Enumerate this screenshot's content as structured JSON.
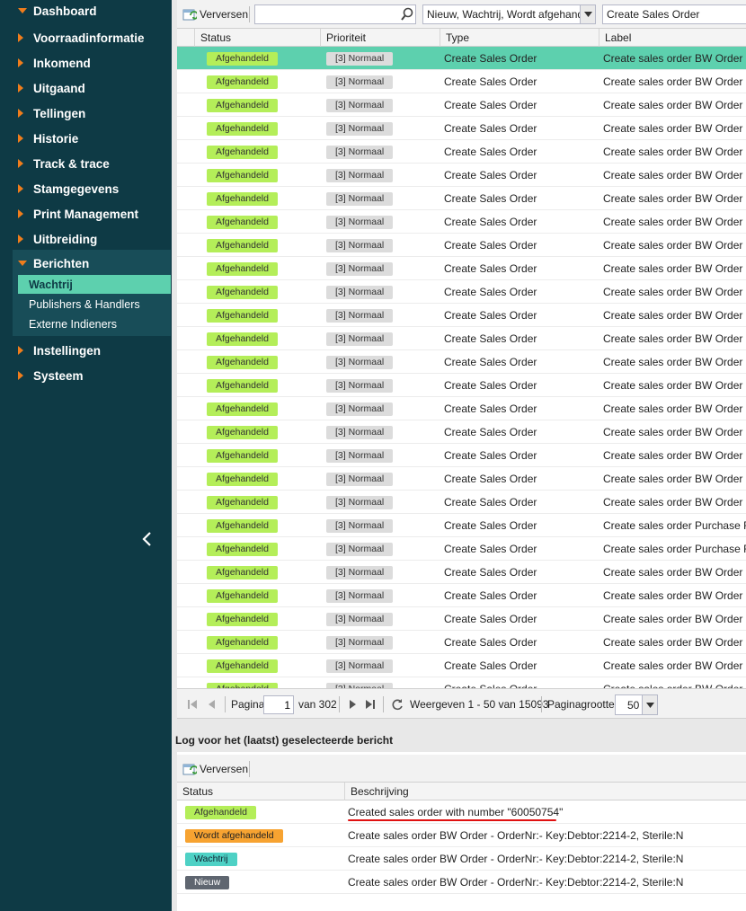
{
  "sidebar": {
    "items": [
      {
        "label": "Dashboard",
        "expanded": true
      },
      {
        "label": "Voorraadinformatie",
        "expanded": false
      },
      {
        "label": "Inkomend",
        "expanded": false
      },
      {
        "label": "Uitgaand",
        "expanded": false
      },
      {
        "label": "Tellingen",
        "expanded": false
      },
      {
        "label": "Historie",
        "expanded": false
      },
      {
        "label": "Track & trace",
        "expanded": false
      },
      {
        "label": "Stamgegevens",
        "expanded": false
      },
      {
        "label": "Print Management",
        "expanded": false
      },
      {
        "label": "Uitbreiding",
        "expanded": false
      },
      {
        "label": "Berichten",
        "expanded": true
      },
      {
        "label": "Instellingen",
        "expanded": false
      },
      {
        "label": "Systeem",
        "expanded": false
      }
    ],
    "sub_items": [
      {
        "label": "Wachtrij",
        "active": true
      },
      {
        "label": "Publishers & Handlers",
        "active": false
      },
      {
        "label": "Externe Indieners",
        "active": false
      }
    ],
    "collapse_icon": "chevron-left-icon"
  },
  "toolbar": {
    "refresh_label": "Verversen",
    "search_value": "",
    "status_filter": "Nieuw, Wachtrij, Wordt afgehandeld",
    "type_filter": "Create Sales Order"
  },
  "grid": {
    "columns": [
      "Status",
      "Prioriteit",
      "Type",
      "Label"
    ],
    "rows": [
      {
        "status": "Afgehandeld",
        "priority": "[3] Normaal",
        "type": "Create Sales Order",
        "label": "Create sales order BW Order - O",
        "selected": true
      },
      {
        "status": "Afgehandeld",
        "priority": "[3] Normaal",
        "type": "Create Sales Order",
        "label": "Create sales order BW Order - O"
      },
      {
        "status": "Afgehandeld",
        "priority": "[3] Normaal",
        "type": "Create Sales Order",
        "label": "Create sales order BW Order - O"
      },
      {
        "status": "Afgehandeld",
        "priority": "[3] Normaal",
        "type": "Create Sales Order",
        "label": "Create sales order BW Order - O"
      },
      {
        "status": "Afgehandeld",
        "priority": "[3] Normaal",
        "type": "Create Sales Order",
        "label": "Create sales order BW Order - O"
      },
      {
        "status": "Afgehandeld",
        "priority": "[3] Normaal",
        "type": "Create Sales Order",
        "label": "Create sales order BW Order - O"
      },
      {
        "status": "Afgehandeld",
        "priority": "[3] Normaal",
        "type": "Create Sales Order",
        "label": "Create sales order BW Order - O"
      },
      {
        "status": "Afgehandeld",
        "priority": "[3] Normaal",
        "type": "Create Sales Order",
        "label": "Create sales order BW Order - O"
      },
      {
        "status": "Afgehandeld",
        "priority": "[3] Normaal",
        "type": "Create Sales Order",
        "label": "Create sales order BW Order - O"
      },
      {
        "status": "Afgehandeld",
        "priority": "[3] Normaal",
        "type": "Create Sales Order",
        "label": "Create sales order BW Order - O"
      },
      {
        "status": "Afgehandeld",
        "priority": "[3] Normaal",
        "type": "Create Sales Order",
        "label": "Create sales order BW Order - O"
      },
      {
        "status": "Afgehandeld",
        "priority": "[3] Normaal",
        "type": "Create Sales Order",
        "label": "Create sales order BW Order - O"
      },
      {
        "status": "Afgehandeld",
        "priority": "[3] Normaal",
        "type": "Create Sales Order",
        "label": "Create sales order BW Order - O"
      },
      {
        "status": "Afgehandeld",
        "priority": "[3] Normaal",
        "type": "Create Sales Order",
        "label": "Create sales order BW Order - O"
      },
      {
        "status": "Afgehandeld",
        "priority": "[3] Normaal",
        "type": "Create Sales Order",
        "label": "Create sales order BW Order - O"
      },
      {
        "status": "Afgehandeld",
        "priority": "[3] Normaal",
        "type": "Create Sales Order",
        "label": "Create sales order BW Order - O"
      },
      {
        "status": "Afgehandeld",
        "priority": "[3] Normaal",
        "type": "Create Sales Order",
        "label": "Create sales order BW Order - O"
      },
      {
        "status": "Afgehandeld",
        "priority": "[3] Normaal",
        "type": "Create Sales Order",
        "label": "Create sales order BW Order - O"
      },
      {
        "status": "Afgehandeld",
        "priority": "[3] Normaal",
        "type": "Create Sales Order",
        "label": "Create sales order BW Order - O"
      },
      {
        "status": "Afgehandeld",
        "priority": "[3] Normaal",
        "type": "Create Sales Order",
        "label": "Create sales order BW Order - O"
      },
      {
        "status": "Afgehandeld",
        "priority": "[3] Normaal",
        "type": "Create Sales Order",
        "label": "Create sales order Purchase Rec"
      },
      {
        "status": "Afgehandeld",
        "priority": "[3] Normaal",
        "type": "Create Sales Order",
        "label": "Create sales order Purchase Rec"
      },
      {
        "status": "Afgehandeld",
        "priority": "[3] Normaal",
        "type": "Create Sales Order",
        "label": "Create sales order BW Order - O"
      },
      {
        "status": "Afgehandeld",
        "priority": "[3] Normaal",
        "type": "Create Sales Order",
        "label": "Create sales order BW Order - O"
      },
      {
        "status": "Afgehandeld",
        "priority": "[3] Normaal",
        "type": "Create Sales Order",
        "label": "Create sales order BW Order - O"
      },
      {
        "status": "Afgehandeld",
        "priority": "[3] Normaal",
        "type": "Create Sales Order",
        "label": "Create sales order BW Order - O"
      },
      {
        "status": "Afgehandeld",
        "priority": "[3] Normaal",
        "type": "Create Sales Order",
        "label": "Create sales order BW Order - O"
      },
      {
        "status": "Afgehandeld",
        "priority": "[3] Normaal",
        "type": "Create Sales Order",
        "label": "Create sales order BW Order - O"
      }
    ]
  },
  "pager": {
    "page_label": "Pagina",
    "page_value": "1",
    "of_label": "van 302",
    "display_text": "Weergeven 1 - 50 van 15093",
    "page_size_label": "Paginagrootte:",
    "page_size_value": "50"
  },
  "log": {
    "title": "Log voor het (laatst) geselecteerde bericht",
    "refresh_label": "Verversen",
    "columns": [
      "Status",
      "Beschrijving"
    ],
    "rows": [
      {
        "status": "Afgehandeld",
        "variant": "done",
        "description": "Created sales order with number \"60050754\""
      },
      {
        "status": "Wordt afgehandeld",
        "variant": "busy",
        "description": "Create sales order BW Order - OrderNr:- Key:Debtor:2214-2, Sterile:N"
      },
      {
        "status": "Wachtrij",
        "variant": "queue",
        "description": "Create sales order BW Order - OrderNr:- Key:Debtor:2214-2, Sterile:N"
      },
      {
        "status": "Nieuw",
        "variant": "new",
        "description": "Create sales order BW Order - OrderNr:- Key:Debtor:2214-2, Sterile:N"
      }
    ]
  }
}
